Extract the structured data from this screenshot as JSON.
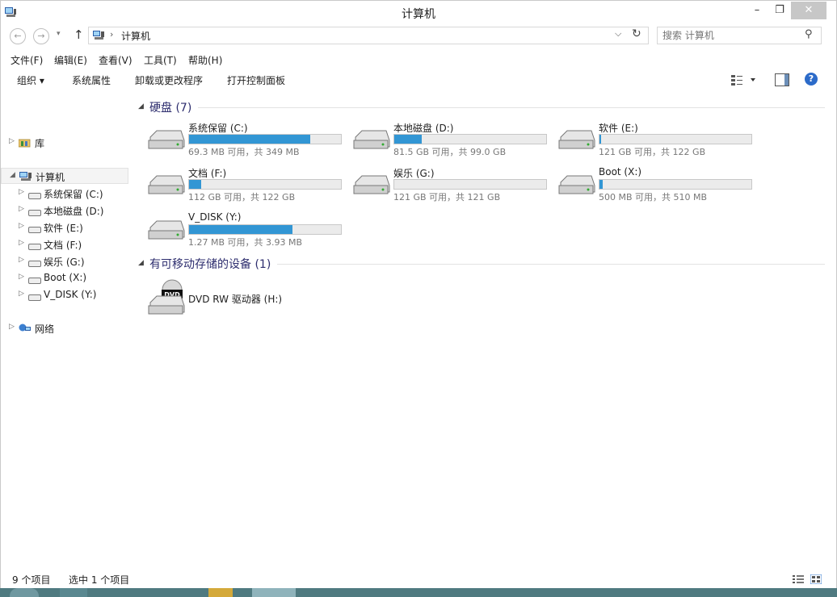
{
  "window": {
    "title": "计算机"
  },
  "address": {
    "crumb": "计算机",
    "separator": "›"
  },
  "search": {
    "placeholder": "搜索 计算机"
  },
  "menu": [
    "文件(F)",
    "编辑(E)",
    "查看(V)",
    "工具(T)",
    "帮助(H)"
  ],
  "commands": {
    "organize": "组织 ▾",
    "system_properties": "系统属性",
    "uninstall": "卸载或更改程序",
    "control_panel": "打开控制面板"
  },
  "nav": {
    "libraries": "库",
    "computer": "计算机",
    "drives": [
      "系统保留 (C:)",
      "本地磁盘 (D:)",
      "软件 (E:)",
      "文档 (F:)",
      "娱乐 (G:)",
      "Boot (X:)",
      "V_DISK (Y:)"
    ],
    "network": "网络"
  },
  "groups": {
    "hdd_title": "硬盘 (7)",
    "removable_title": "有可移动存储的设备 (1)"
  },
  "drives": [
    {
      "name": "系统保留 (C:)",
      "info": "69.3 MB 可用，共 349 MB",
      "used_fraction": 0.8
    },
    {
      "name": "本地磁盘 (D:)",
      "info": "81.5 GB 可用，共 99.0 GB",
      "used_fraction": 0.18
    },
    {
      "name": "软件 (E:)",
      "info": "121 GB 可用，共 122 GB",
      "used_fraction": 0.01
    },
    {
      "name": "文档 (F:)",
      "info": "112 GB 可用，共 122 GB",
      "used_fraction": 0.08
    },
    {
      "name": "娱乐 (G:)",
      "info": "121 GB 可用，共 121 GB",
      "used_fraction": 0.0
    },
    {
      "name": "Boot (X:)",
      "info": "500 MB 可用，共 510 MB",
      "used_fraction": 0.02
    },
    {
      "name": "V_DISK (Y:)",
      "info": "1.27 MB 可用，共 3.93 MB",
      "used_fraction": 0.68
    }
  ],
  "dvd": {
    "name": "DVD RW 驱动器 (H:)",
    "label": "DVD"
  },
  "status": {
    "count": "9 个项目",
    "selected": "选中 1 个项目"
  },
  "colors": {
    "usage_bar": "#3296d4",
    "group_title": "#2d2d6e",
    "taskbar": "#4f7a80"
  }
}
